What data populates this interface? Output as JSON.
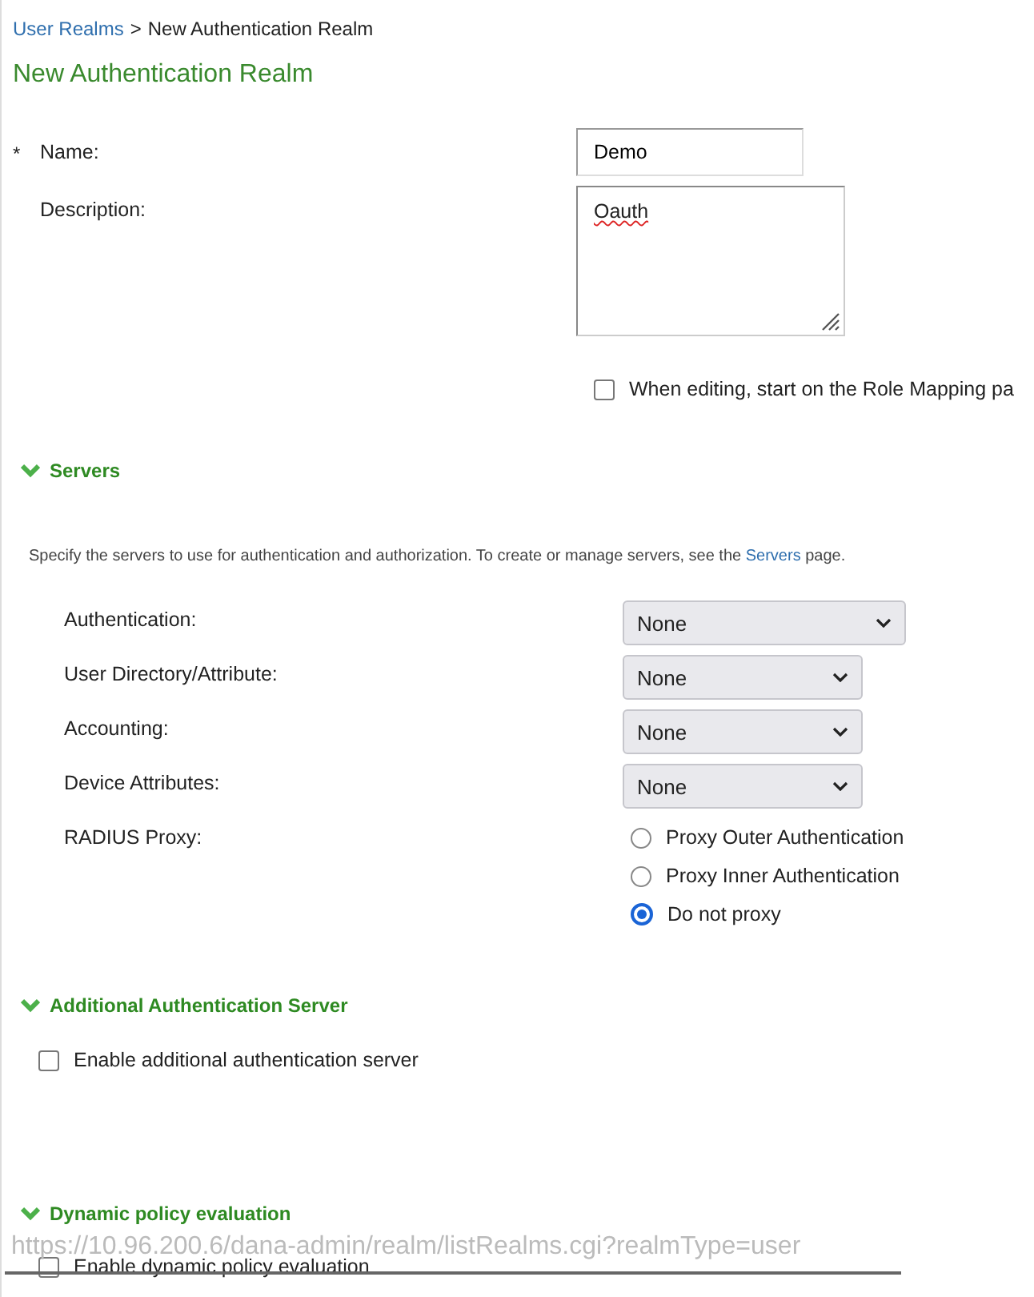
{
  "breadcrumb": {
    "link": "User Realms",
    "separator": ">",
    "current": "New Authentication Realm"
  },
  "title": "New Authentication Realm",
  "fields": [
    {
      "required_mark": "*",
      "label": "Name:",
      "kind": "input",
      "value": "Demo"
    },
    {
      "label": "Description:",
      "kind": "textarea",
      "value": "Oauth"
    }
  ],
  "role_mapping_option": {
    "label": "When editing, start on the Role Mapping pa",
    "checked": false
  },
  "servers": {
    "heading": "Servers",
    "expanded": true,
    "intro": {
      "before": "Specify the servers to use for authentication and authorization. To create or manage servers, see the",
      "link": "Servers",
      "after": "page."
    },
    "rows": [
      {
        "label": "Authentication:",
        "kind": "select",
        "value": "None",
        "wide": true
      },
      {
        "label": "User Directory/Attribute:",
        "kind": "select",
        "value": "None",
        "wide": false
      },
      {
        "label": "Accounting:",
        "kind": "select",
        "value": "None",
        "wide": false
      },
      {
        "label": "Device Attributes:",
        "kind": "select",
        "value": "None",
        "wide": false
      },
      {
        "label": "RADIUS Proxy:",
        "kind": "radio",
        "options": [
          {
            "label": "Proxy Outer Authentication",
            "selected": false
          },
          {
            "label": "Proxy Inner Authentication",
            "selected": false
          },
          {
            "label": "Do not proxy",
            "selected": true
          }
        ]
      }
    ]
  },
  "additional_server": {
    "heading": "Additional Authentication Server",
    "expanded": true,
    "option": {
      "label": "Enable additional authentication server",
      "checked": false
    }
  },
  "dynamic_policy": {
    "heading": "Dynamic policy evaluation",
    "expanded": true,
    "option": {
      "label": "Enable dynamic policy evaluation",
      "checked": false
    }
  },
  "status_url": "https://10.96.200.6/dana-admin/realm/listRealms.cgi?realmType=user"
}
